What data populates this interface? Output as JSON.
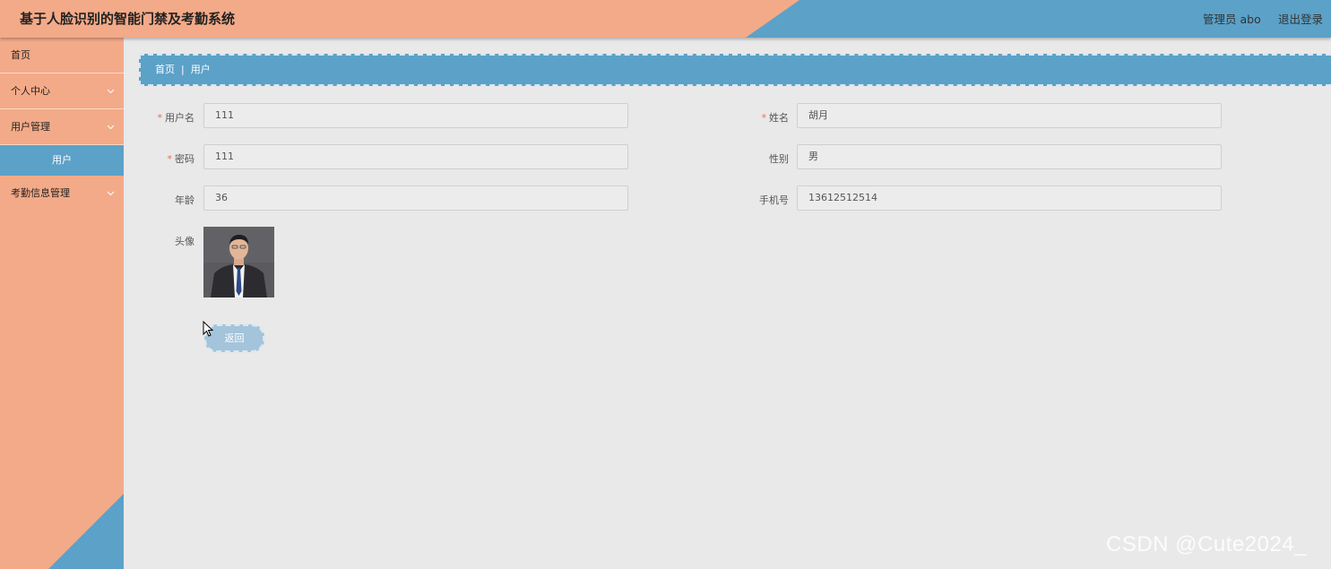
{
  "header": {
    "title": "基于人脸识别的智能门禁及考勤系统",
    "user_label": "管理员 abo",
    "logout_label": "退出登录",
    "primary_color": "#f3aa88",
    "accent_color": "#5ca1c8"
  },
  "sidebar": {
    "items": [
      {
        "label": "首页"
      },
      {
        "label": "个人中心",
        "icon": "chevron-down-icon"
      },
      {
        "label": "用户管理",
        "icon": "chevron-down-icon"
      },
      {
        "label": "用户",
        "active": true
      },
      {
        "label": "考勤信息管理",
        "icon": "chevron-down-icon"
      }
    ]
  },
  "breadcrumb": {
    "home": "首页",
    "separator": "|",
    "current": "用户"
  },
  "form": {
    "username": {
      "label": "用户名",
      "required": true,
      "value": "111"
    },
    "name": {
      "label": "姓名",
      "required": true,
      "value": "胡月"
    },
    "password": {
      "label": "密码",
      "required": true,
      "value": "111"
    },
    "gender": {
      "label": "性别",
      "value": "男"
    },
    "age": {
      "label": "年龄",
      "value": "36"
    },
    "phone": {
      "label": "手机号",
      "value": "13612512514"
    },
    "avatar": {
      "label": "头像"
    },
    "back_label": "返回"
  },
  "watermark": "CSDN @Cute2024_"
}
